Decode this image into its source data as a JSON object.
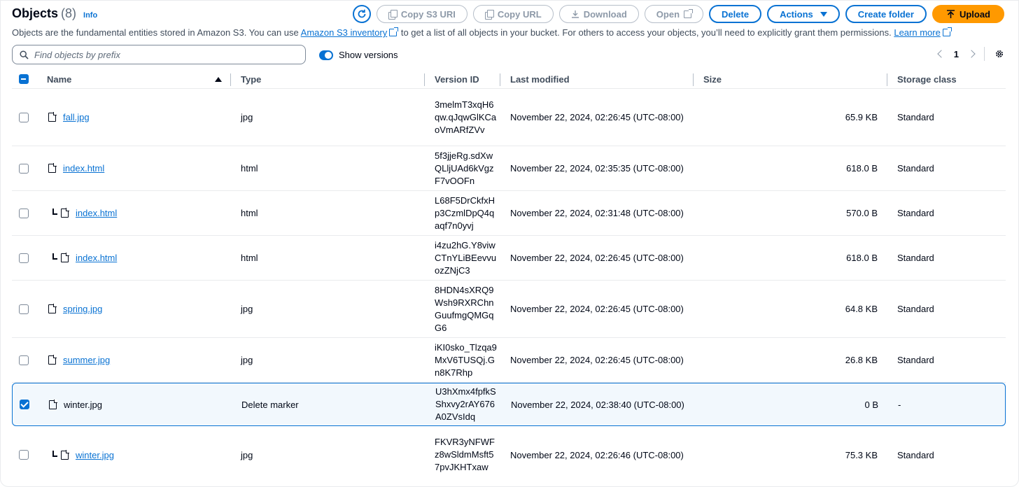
{
  "header": {
    "title": "Objects",
    "count": "(8)",
    "info": "Info",
    "description_pre": "Objects are the fundamental entities stored in Amazon S3. You can use ",
    "inventory_link": "Amazon S3 inventory",
    "description_mid": " to get a list of all objects in your bucket. For others to access your objects, you’ll need to explicitly grant them permissions. ",
    "learn_more": "Learn more"
  },
  "toolbar": {
    "copy_s3_uri": "Copy S3 URI",
    "copy_url": "Copy URL",
    "download": "Download",
    "open": "Open",
    "delete": "Delete",
    "actions": "Actions",
    "create_folder": "Create folder",
    "upload": "Upload"
  },
  "search": {
    "placeholder": "Find objects by prefix"
  },
  "show_versions": {
    "label": "Show versions",
    "enabled": true
  },
  "pagination": {
    "page": "1"
  },
  "columns": [
    "Name",
    "Type",
    "Version ID",
    "Last modified",
    "Size",
    "Storage class"
  ],
  "rows": [
    {
      "name": "fall.jpg",
      "type": "jpg",
      "version_id": "3melmT3xqH6qw.qJqwGlKCaoVmARfZVv",
      "last_modified": "November 22, 2024, 02:26:45 (UTC-08:00)",
      "size": "65.9 KB",
      "storage_class": "Standard",
      "nested": false,
      "link": true,
      "checked": false
    },
    {
      "name": "index.html",
      "type": "html",
      "version_id": "5f3jjeRg.sdXwQLljUAd6kVgzF7vOOFn",
      "last_modified": "November 22, 2024, 02:35:35 (UTC-08:00)",
      "size": "618.0 B",
      "storage_class": "Standard",
      "nested": false,
      "link": true,
      "checked": false
    },
    {
      "name": "index.html",
      "type": "html",
      "version_id": "L68F5DrCkfxHp3CzmlDpQ4qaqf7n0yvj",
      "last_modified": "November 22, 2024, 02:31:48 (UTC-08:00)",
      "size": "570.0 B",
      "storage_class": "Standard",
      "nested": true,
      "link": true,
      "checked": false
    },
    {
      "name": "index.html",
      "type": "html",
      "version_id": "i4zu2hG.Y8viwCTnYLiBEevvuozZNjC3",
      "last_modified": "November 22, 2024, 02:26:45 (UTC-08:00)",
      "size": "618.0 B",
      "storage_class": "Standard",
      "nested": true,
      "link": true,
      "checked": false
    },
    {
      "name": "spring.jpg",
      "type": "jpg",
      "version_id": "8HDN4sXRQ9Wsh9RXRChnGuufmgQMGqG6",
      "last_modified": "November 22, 2024, 02:26:45 (UTC-08:00)",
      "size": "64.8 KB",
      "storage_class": "Standard",
      "nested": false,
      "link": true,
      "checked": false
    },
    {
      "name": "summer.jpg",
      "type": "jpg",
      "version_id": "iKI0sko_Tlzqa9MxV6TUSQj.Gn8K7Rhp",
      "last_modified": "November 22, 2024, 02:26:45 (UTC-08:00)",
      "size": "26.8 KB",
      "storage_class": "Standard",
      "nested": false,
      "link": true,
      "checked": false
    },
    {
      "name": "winter.jpg",
      "type": "Delete marker",
      "version_id": "U3hXmx4fpfkSShxvy2rAY676A0ZVsIdq",
      "last_modified": "November 22, 2024, 02:38:40 (UTC-08:00)",
      "size": "0 B",
      "storage_class": "-",
      "nested": false,
      "link": false,
      "checked": true
    },
    {
      "name": "winter.jpg",
      "type": "jpg",
      "version_id": "FKVR3yNFWFz8wSldmMsft57pvJKHTxaw",
      "last_modified": "November 22, 2024, 02:26:46 (UTC-08:00)",
      "size": "75.3 KB",
      "storage_class": "Standard",
      "nested": true,
      "link": true,
      "checked": false
    }
  ],
  "colors": {
    "accent": "#0972d3",
    "upload": "#ff9900",
    "disabled": "#8d99a8"
  }
}
